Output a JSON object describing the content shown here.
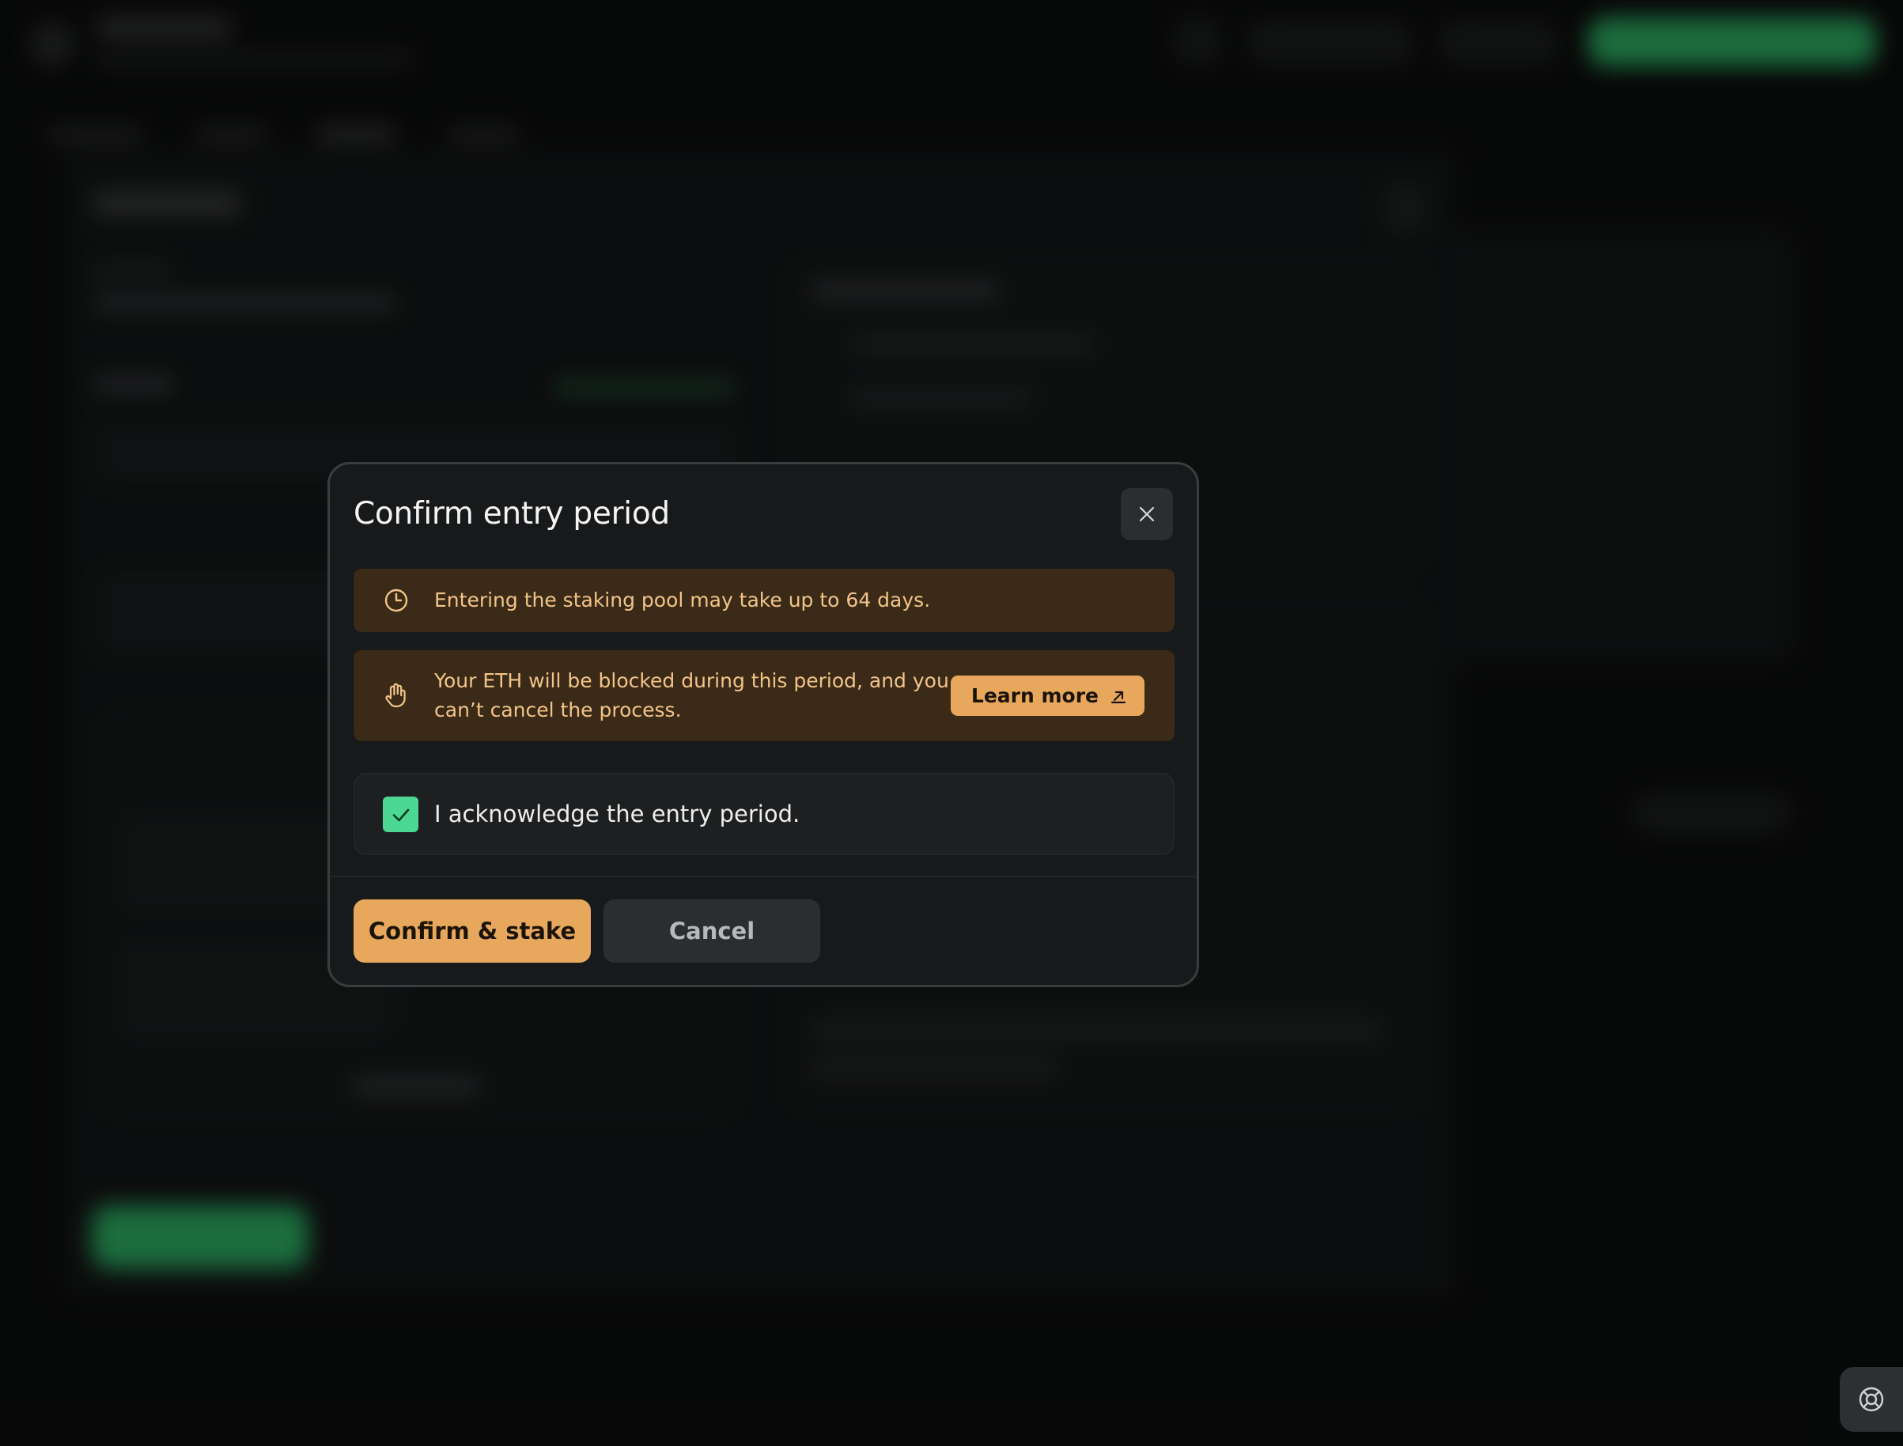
{
  "modal": {
    "title": "Confirm entry period",
    "notice_entry": "Entering the staking pool may take up to 64 days.",
    "notice_blocked": "Your ETH will be blocked during this period, and you can’t cancel the process.",
    "learn_more_label": "Learn more",
    "acknowledge_label": "I acknowledge the entry period.",
    "acknowledge_checked": true,
    "confirm_label": "Confirm & stake",
    "cancel_label": "Cancel"
  },
  "icons": {
    "close": "close-icon",
    "clock": "clock-icon",
    "hand": "hand-stop-icon",
    "external_link": "external-link-icon",
    "check": "check-icon",
    "help": "lifebuoy-icon"
  },
  "colors": {
    "accent": "#e7a85d",
    "warning_bg": "#3a2a17",
    "warning_text": "#f3c48a",
    "check_green": "#4cd792",
    "background_button_green": "#2fb868"
  }
}
